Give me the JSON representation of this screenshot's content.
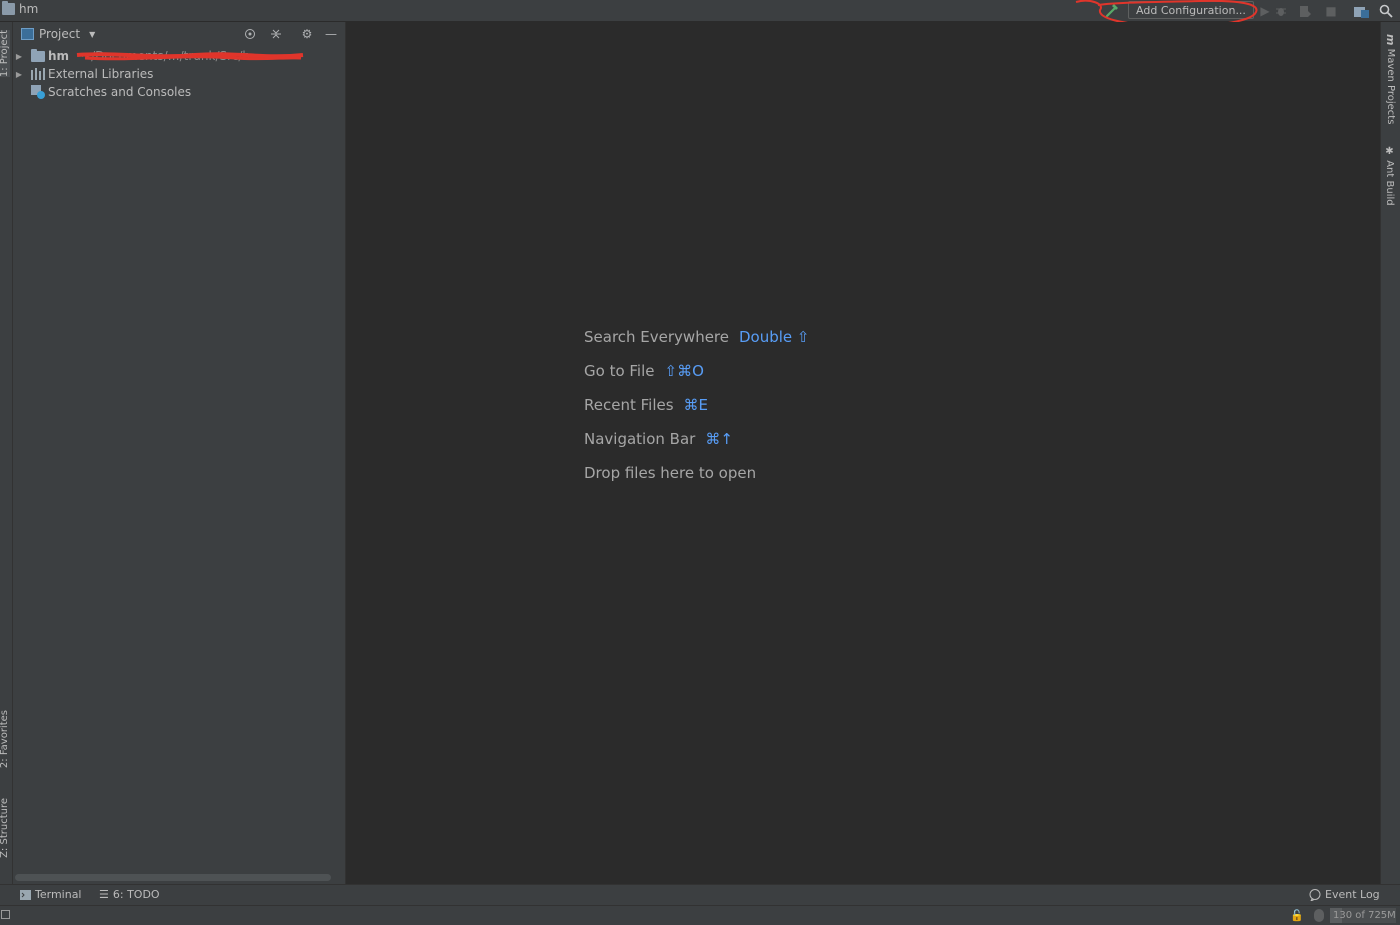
{
  "navbar": {
    "breadcrumb": "hm",
    "add_configuration": "Add Configuration..."
  },
  "left_strip": {
    "project_tab": "1: Project",
    "favorites_tab": "2: Favorites",
    "structure_tab": "Z: Structure"
  },
  "project_panel": {
    "title": "Project",
    "tree": [
      {
        "label": "hm",
        "path": "~/Documents/…/trunk/Src/h",
        "expandable": true
      },
      {
        "label": "External Libraries",
        "expandable": true
      },
      {
        "label": "Scratches and Consoles",
        "expandable": false
      }
    ]
  },
  "editor": {
    "hints": [
      {
        "label": "Search Everywhere",
        "key": "Double ⇧"
      },
      {
        "label": "Go to File",
        "key": "⇧⌘O"
      },
      {
        "label": "Recent Files",
        "key": "⌘E"
      },
      {
        "label": "Navigation Bar",
        "key": "⌘↑"
      },
      {
        "label": "Drop files here to open",
        "key": ""
      }
    ]
  },
  "right_strip": {
    "maven_tab": "Maven Projects",
    "ant_tab": "Ant Build"
  },
  "bottom_tools": {
    "terminal": "Terminal",
    "todo": "6: TODO",
    "event_log": "Event Log"
  },
  "status": {
    "memory": "130 of 725M",
    "memory_used_fraction": 0.18
  },
  "colors": {
    "background": "#2b2b2b",
    "panel": "#3c3f41",
    "shortcut": "#589df6",
    "annotation": "#e0352b"
  }
}
